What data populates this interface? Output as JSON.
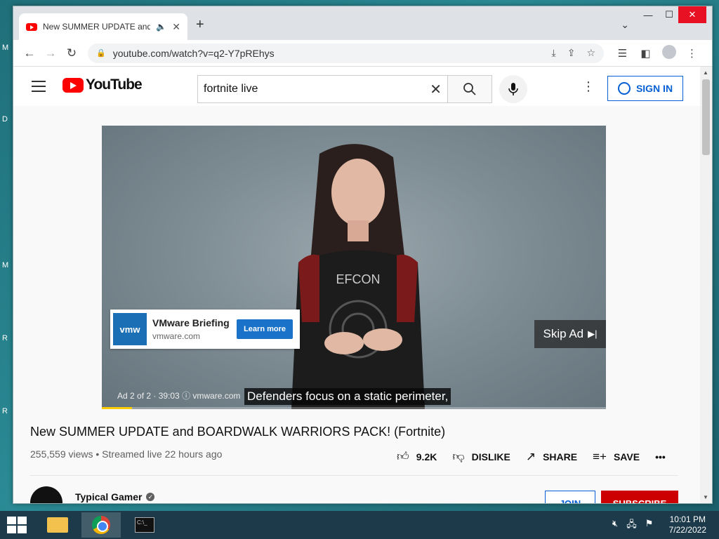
{
  "desktop": {
    "side_letters": [
      "M",
      "D",
      "M",
      "R",
      "R"
    ]
  },
  "browser": {
    "tab_title": "New SUMMER UPDATE and /",
    "url": "youtube.com/watch?v=q2-Y7pREhys"
  },
  "youtube": {
    "logo_text": "YouTube",
    "search_value": "fortnite live",
    "sign_in": "SIGN IN",
    "ad": {
      "brand_logo": "vmw",
      "title": "VMware Briefing",
      "domain": "vmware.com",
      "learn_more": "Learn more",
      "skip": "Skip Ad",
      "meta": "Ad 2 of 2 · 39:03  ⓘ  vmware.com",
      "progress_fraction": 0.06
    },
    "subtitle": "Defenders focus on a static perimeter,",
    "video_title": "New SUMMER UPDATE and BOARDWALK WARRIORS PACK! (Fortnite)",
    "meta": "255,559 views • Streamed live 22 hours ago",
    "actions": {
      "likes": "9.2K",
      "dislike": "DISLIKE",
      "share": "SHARE",
      "save": "SAVE"
    },
    "channel": {
      "name": "Typical Gamer",
      "join": "JOIN",
      "subscribe": "SUBSCRIBE"
    }
  },
  "taskbar": {
    "time": "10:01 PM",
    "date": "7/22/2022"
  }
}
